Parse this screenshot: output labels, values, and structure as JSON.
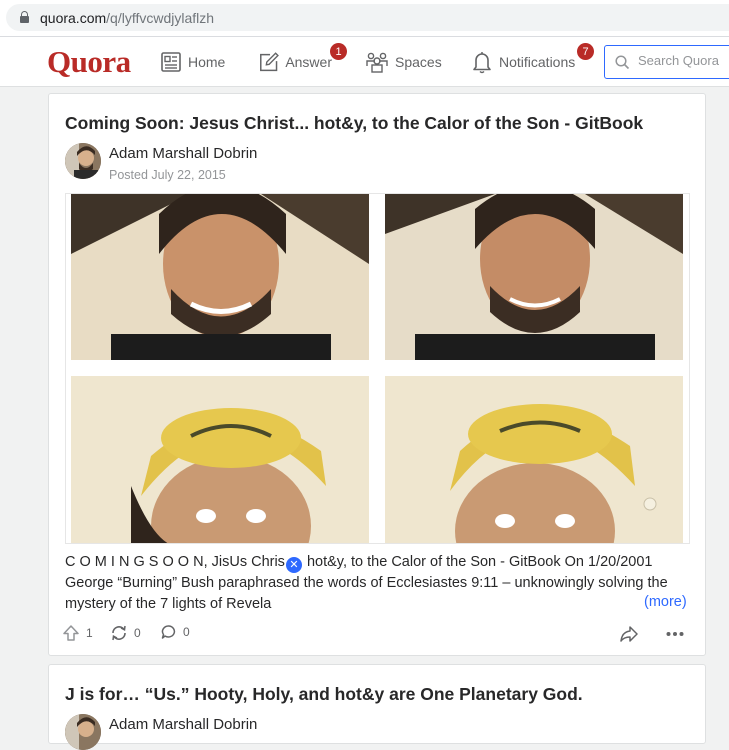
{
  "browser": {
    "url_domain": "quora.com",
    "url_path": "/q/lyffvcwdjylaflzh"
  },
  "nav": {
    "logo": "Quora",
    "home": "Home",
    "answer": "Answer",
    "answer_badge": "1",
    "spaces": "Spaces",
    "notifications": "Notifications",
    "notifications_badge": "7",
    "search_placeholder": "Search Quora"
  },
  "colors": {
    "brand": "#b92b27",
    "link": "#2e69ff",
    "badge": "#b92b27"
  },
  "post1": {
    "title": "Coming Soon: Jesus Christ... hot&y, to the Calor of the Son - GitBook",
    "author": "Adam Marshall Dobrin",
    "posted": "Posted July 22, 2015",
    "excerpt_before_icon": "C O M I N G S O O N, JisUs Chris",
    "excerpt_after_icon": " hot&y, to the Calor of the Son - GitBook On 1/20/2001 George “Burning” Bush paraphrased the words of Ecclesiastes 9:11 – unknowingly solving the mystery of the 7 lights of Revela",
    "more": "(more)",
    "upvotes": "1",
    "shares": "0",
    "comments": "0"
  },
  "post2": {
    "title": "J is for… “Us.” Hooty, Holy, and hot&y are One Planetary God.",
    "author": "Adam Marshall Dobrin"
  }
}
